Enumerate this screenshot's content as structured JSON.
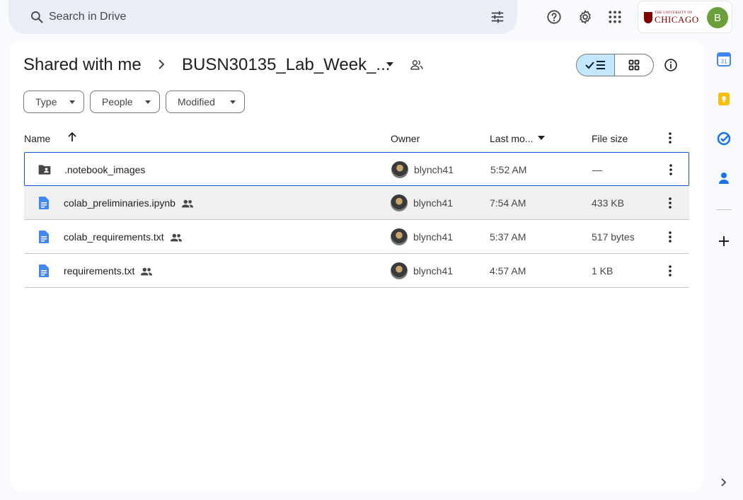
{
  "search": {
    "placeholder": "Search in Drive"
  },
  "account": {
    "org_small": "THE UNIVERSITY OF",
    "org_big": "CHICAGO",
    "avatar_letter": "B"
  },
  "breadcrumb": {
    "root": "Shared with me",
    "folder": "BUSN30135_Lab_Week_..."
  },
  "filters": {
    "type": "Type",
    "people": "People",
    "modified": "Modified"
  },
  "table": {
    "headers": {
      "name": "Name",
      "owner": "Owner",
      "modified": "Last mo...",
      "size": "File size"
    },
    "rows": [
      {
        "name": ".notebook_images",
        "kind": "shared-folder",
        "shared": false,
        "owner": "blynch41",
        "modified": "5:52 AM",
        "size": "—"
      },
      {
        "name": "colab_preliminaries.ipynb",
        "kind": "document",
        "shared": true,
        "owner": "blynch41",
        "modified": "7:54 AM",
        "size": "433 KB"
      },
      {
        "name": "colab_requirements.txt",
        "kind": "document",
        "shared": true,
        "owner": "blynch41",
        "modified": "5:37 AM",
        "size": "517 bytes"
      },
      {
        "name": "requirements.txt",
        "kind": "document",
        "shared": true,
        "owner": "blynch41",
        "modified": "4:57 AM",
        "size": "1 KB"
      }
    ]
  },
  "rail": {
    "calendar_day": "31"
  },
  "colors": {
    "accent": "#0b57d0",
    "selected_view": "#c2e7ff",
    "doc_icon": "#4285f4",
    "keep": "#fbbc04"
  }
}
